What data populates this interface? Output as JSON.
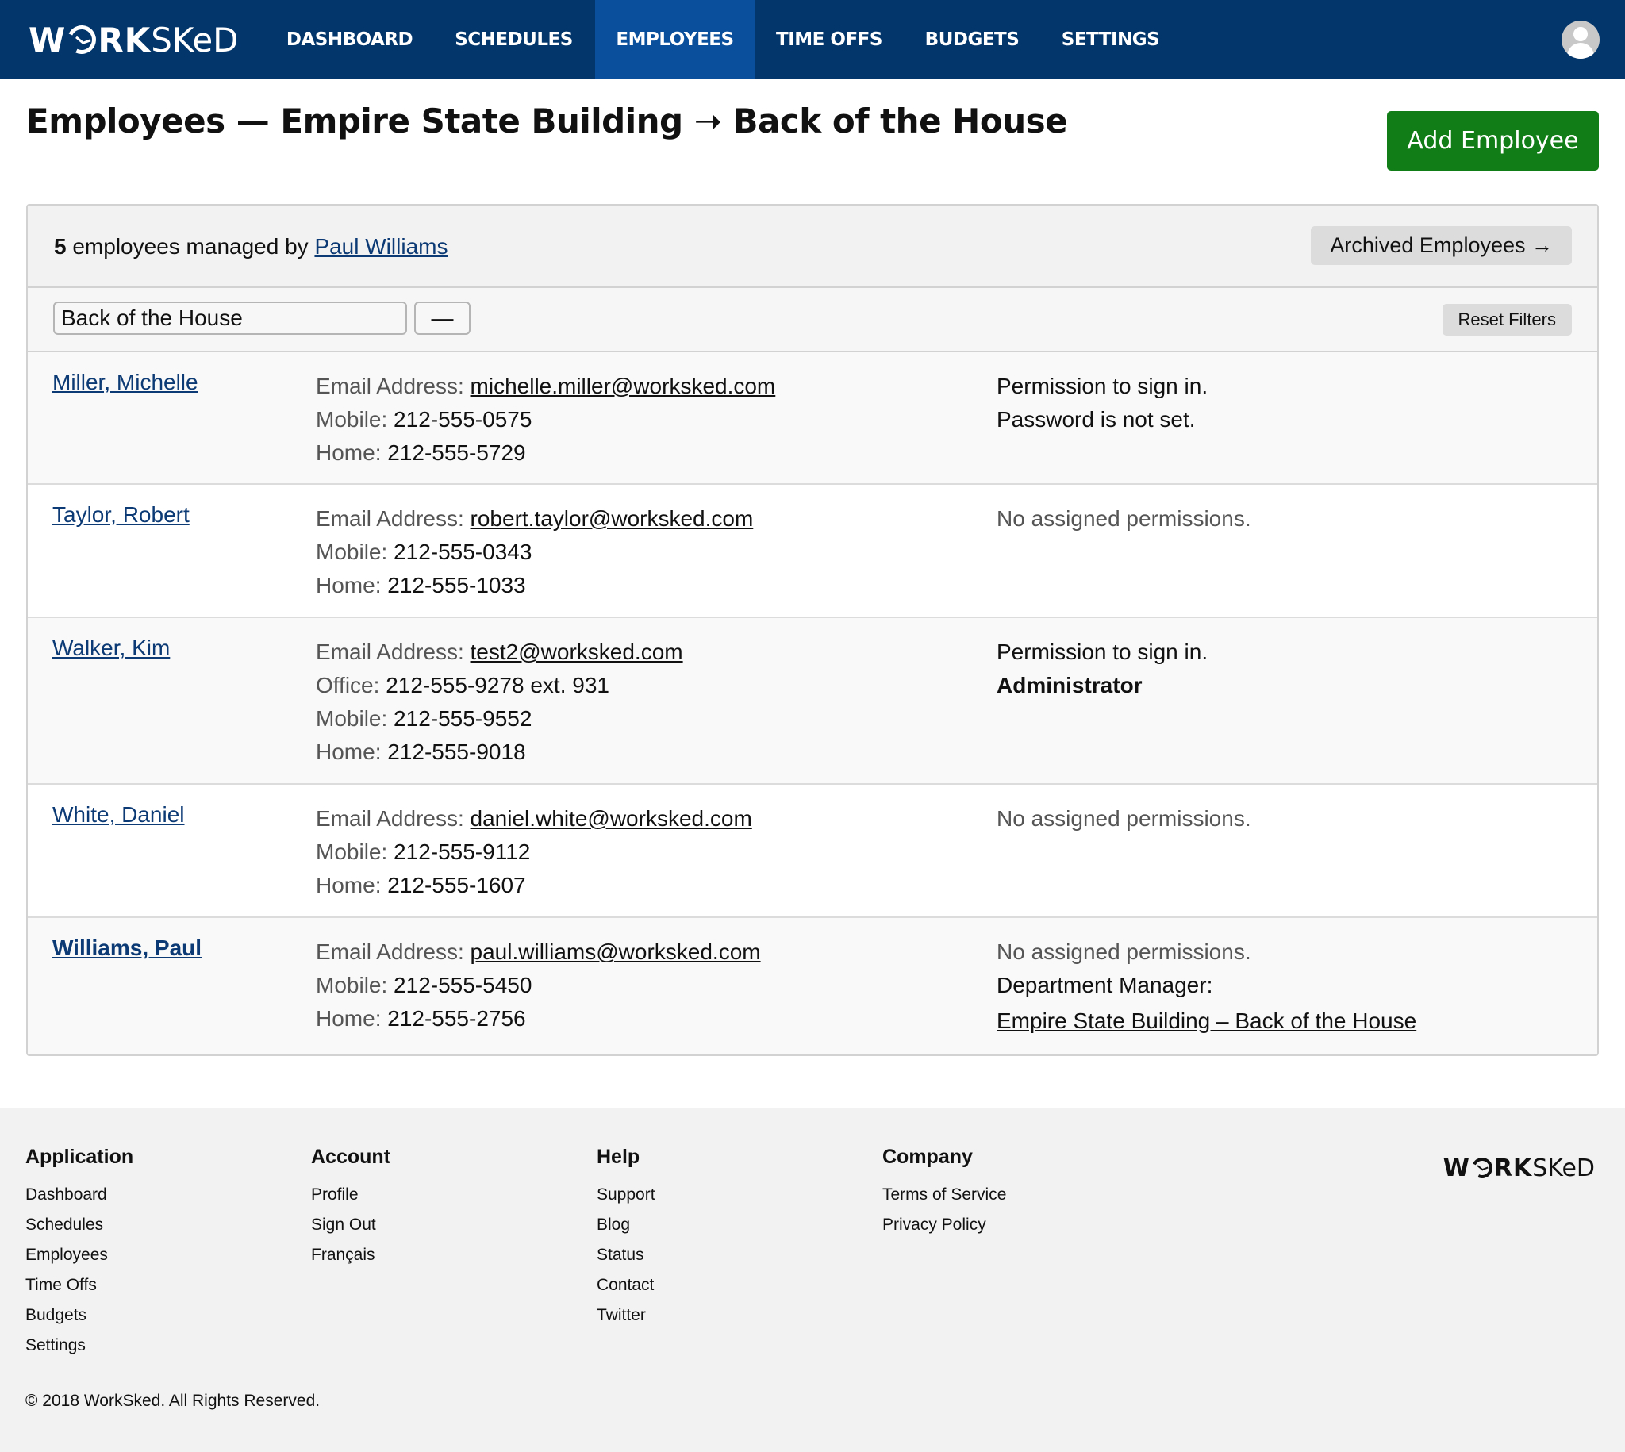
{
  "brand": {
    "logo_prefix": "W",
    "logo_bold": "RK",
    "logo_light": "SKeD"
  },
  "colors": {
    "nav_bg": "#03366b",
    "nav_active": "#0a4f9c",
    "primary_button": "#117d16",
    "link": "#0c3a74"
  },
  "nav": {
    "items": [
      {
        "label": "DASHBOARD",
        "active": false
      },
      {
        "label": "SCHEDULES",
        "active": false
      },
      {
        "label": "EMPLOYEES",
        "active": true
      },
      {
        "label": "TIME OFFS",
        "active": false
      },
      {
        "label": "BUDGETS",
        "active": false
      },
      {
        "label": "SETTINGS",
        "active": false
      }
    ],
    "avatar_icon": "user-avatar-icon"
  },
  "header": {
    "title_strong": "Employees",
    "title_sep": " — ",
    "location": "Empire State Building",
    "arrow": " ➝ ",
    "department": "Back of the House",
    "add_button": "Add Employee"
  },
  "panel": {
    "count": "5",
    "count_text": " employees managed by ",
    "manager": "Paul Williams",
    "archived_button": "Archived Employees →",
    "filters": {
      "department_value": "Back of the House",
      "secondary_value": "—",
      "reset_button": "Reset Filters"
    }
  },
  "employees": [
    {
      "name": "Miller, Michelle",
      "email_label": "Email Address: ",
      "email": "michelle.miller@worksked.com",
      "contacts": [
        {
          "label": "Mobile: ",
          "value": "212-555-0575"
        },
        {
          "label": "Home: ",
          "value": "212-555-5729"
        }
      ],
      "permissions": [
        "Permission to sign in.",
        "Password is not set."
      ]
    },
    {
      "name": "Taylor, Robert",
      "email_label": "Email Address: ",
      "email": "robert.taylor@worksked.com",
      "contacts": [
        {
          "label": "Mobile: ",
          "value": "212-555-0343"
        },
        {
          "label": "Home: ",
          "value": "212-555-1033"
        }
      ],
      "permissions_muted": "No assigned permissions."
    },
    {
      "name": "Walker, Kim",
      "email_label": "Email Address: ",
      "email": "test2@worksked.com",
      "contacts": [
        {
          "label": "Office: ",
          "value": "212-555-9278 ext. 931"
        },
        {
          "label": "Mobile: ",
          "value": "212-555-9552"
        },
        {
          "label": "Home: ",
          "value": "212-555-9018"
        }
      ],
      "permissions": [
        "Permission to sign in."
      ],
      "role": "Administrator"
    },
    {
      "name": "White, Daniel",
      "email_label": "Email Address: ",
      "email": "daniel.white@worksked.com",
      "contacts": [
        {
          "label": "Mobile: ",
          "value": "212-555-9112"
        },
        {
          "label": "Home: ",
          "value": "212-555-1607"
        }
      ],
      "permissions_muted": "No assigned permissions."
    },
    {
      "name": "Williams, Paul",
      "email_label": "Email Address: ",
      "email": "paul.williams@worksked.com",
      "contacts": [
        {
          "label": "Mobile: ",
          "value": "212-555-5450"
        },
        {
          "label": "Home: ",
          "value": "212-555-2756"
        }
      ],
      "permissions_muted": "No assigned permissions.",
      "manager_label": "Department Manager:",
      "manager_of": "Empire State Building – Back of the House"
    }
  ],
  "footer": {
    "columns": [
      {
        "heading": "Application",
        "links": [
          "Dashboard",
          "Schedules",
          "Employees",
          "Time Offs",
          "Budgets",
          "Settings"
        ]
      },
      {
        "heading": "Account",
        "links": [
          "Profile",
          "Sign Out",
          "Français"
        ]
      },
      {
        "heading": "Help",
        "links": [
          "Support",
          "Blog",
          "Status",
          "Contact",
          "Twitter"
        ]
      },
      {
        "heading": "Company",
        "links": [
          "Terms of Service",
          "Privacy Policy"
        ]
      }
    ],
    "copyright": "© 2018 WorkSked. All Rights Reserved."
  }
}
